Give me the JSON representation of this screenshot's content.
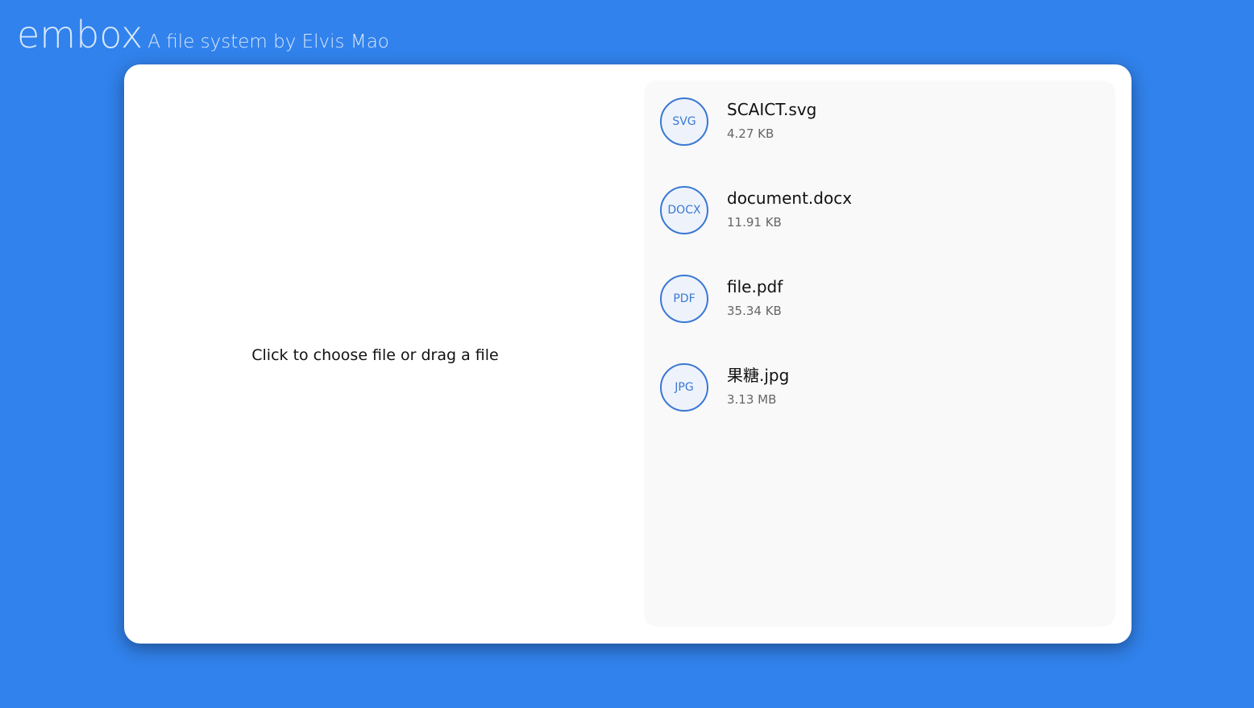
{
  "header": {
    "brand": "embox",
    "tagline": "A file system by Elvis Mao"
  },
  "upload": {
    "prompt": "Click to choose file or drag a file"
  },
  "files": [
    {
      "ext": "SVG",
      "name": "SCAICT.svg",
      "size": "4.27 KB"
    },
    {
      "ext": "DOCX",
      "name": "document.docx",
      "size": "11.91 KB"
    },
    {
      "ext": "PDF",
      "name": "file.pdf",
      "size": "35.34 KB"
    },
    {
      "ext": "JPG",
      "name": "果糖.jpg",
      "size": "3.13 MB"
    }
  ],
  "colors": {
    "background": "#3182ec",
    "accent": "#3a78d4",
    "card": "#ffffff",
    "list_background": "#f9f9f9"
  }
}
